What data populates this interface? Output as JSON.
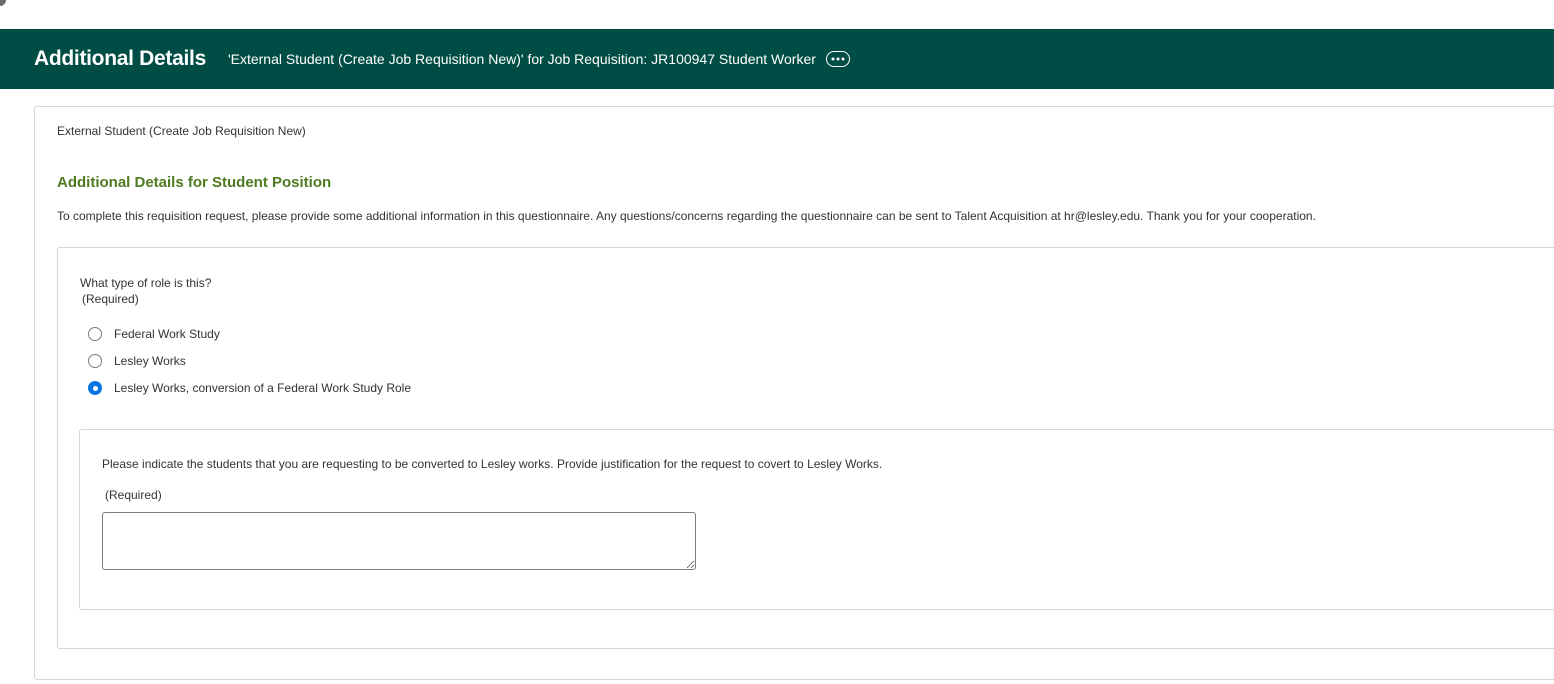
{
  "header": {
    "title": "Additional Details",
    "subtitle": "'External Student (Create Job Requisition New)' for Job Requisition: JR100947 Student Worker",
    "related_actions_icon": "ellipsis-icon",
    "background_color": "#004d45"
  },
  "card": {
    "caption": "External Student (Create Job Requisition New)",
    "section_title": "Additional Details for Student Position",
    "section_title_color": "#4e7a21",
    "intro_text": "To complete this requisition request, please provide some additional information in this questionnaire. Any questions/concerns regarding the questionnaire can be sent to Talent Acquisition at hr@lesley.edu. Thank you for your cooperation."
  },
  "question": {
    "label": "What type of role is this?",
    "required_text": "(Required)",
    "options": [
      {
        "label": "Federal Work Study",
        "selected": false
      },
      {
        "label": "Lesley Works",
        "selected": false
      },
      {
        "label": "Lesley Works, conversion of a Federal Work Study Role",
        "selected": true
      }
    ],
    "selected_color": "#0875e1"
  },
  "follow_up": {
    "label": "Please indicate the students that you are requesting to be converted to Lesley works. Provide justification for the request to covert to Lesley Works.",
    "required_text": "(Required)",
    "value": ""
  }
}
